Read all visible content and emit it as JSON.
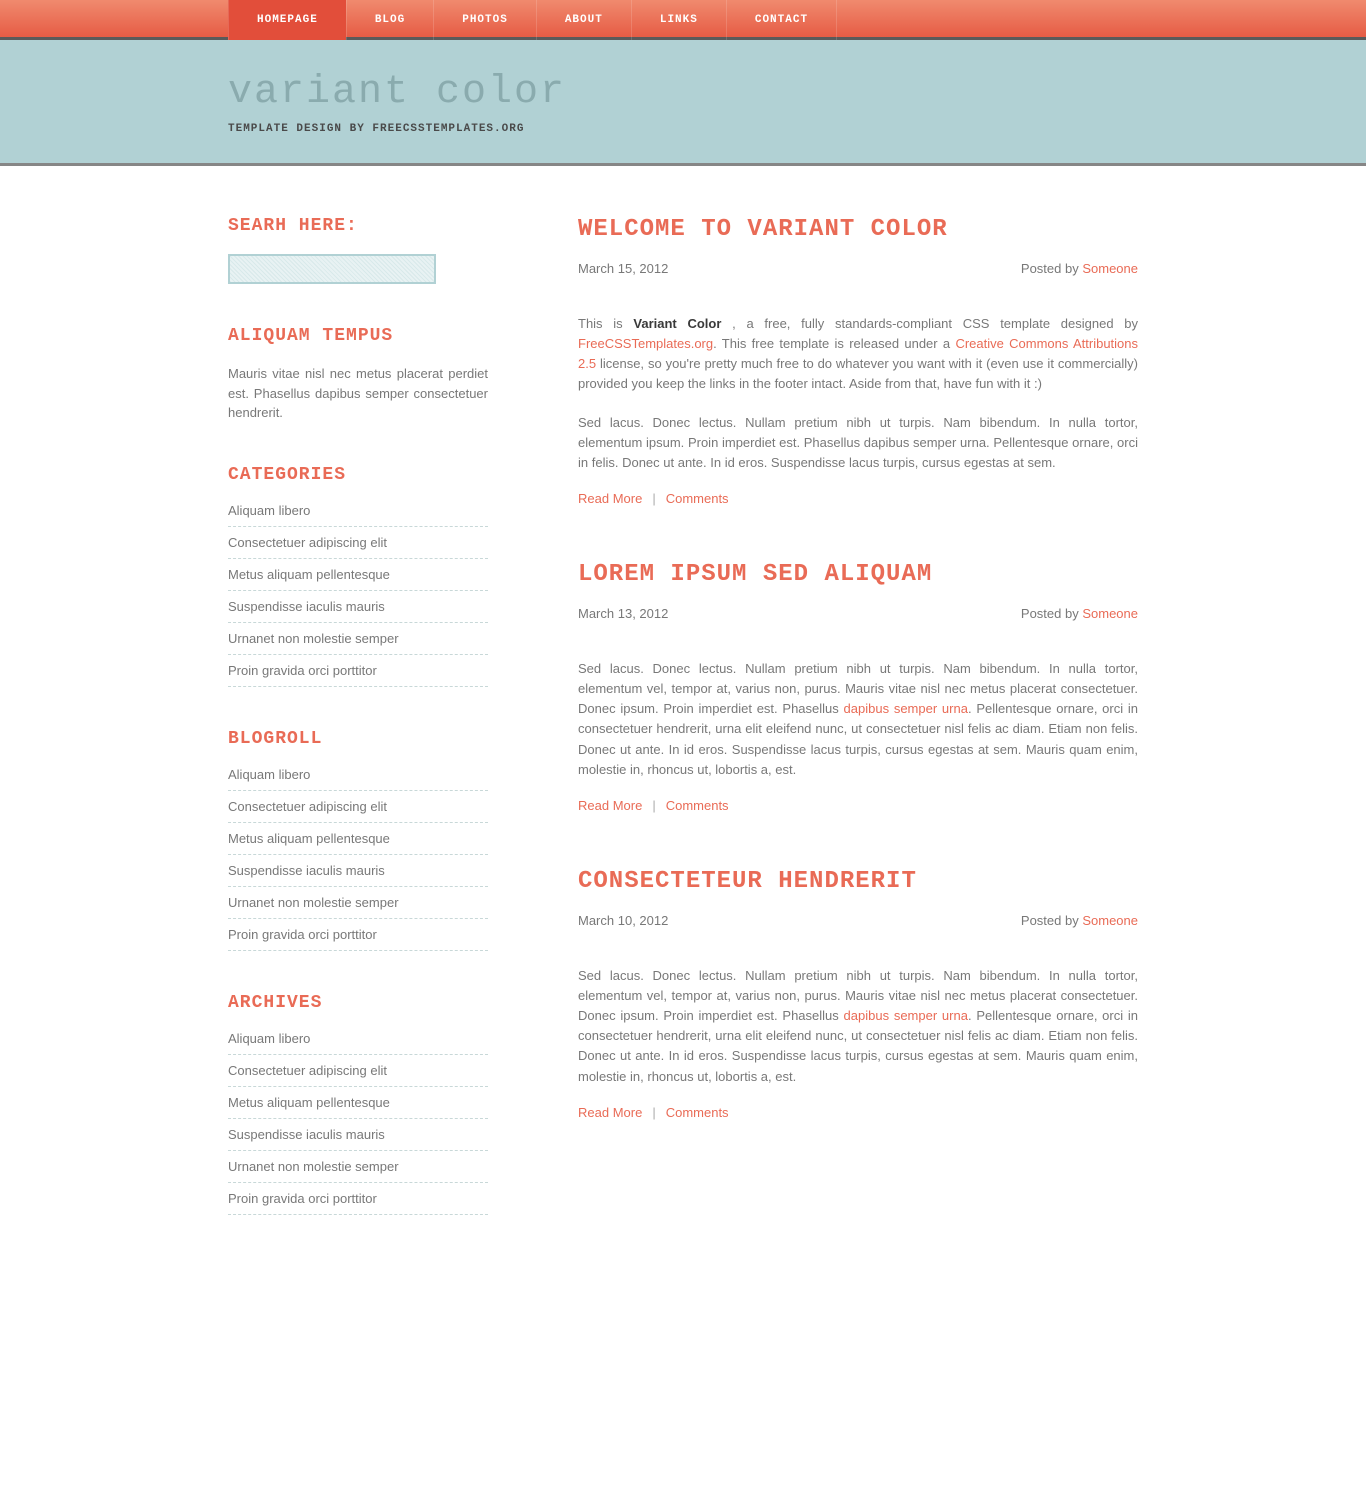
{
  "nav": {
    "items": [
      {
        "label": "Homepage",
        "active": true
      },
      {
        "label": "Blog",
        "active": false
      },
      {
        "label": "Photos",
        "active": false
      },
      {
        "label": "About",
        "active": false
      },
      {
        "label": "Links",
        "active": false
      },
      {
        "label": "Contact",
        "active": false
      }
    ]
  },
  "logo": {
    "title": "variant color",
    "subtitle": "Template design by FreeCSSTemplates.org"
  },
  "sidebar": {
    "search_heading": "Searh Here:",
    "search_value": "",
    "tempus_heading": "Aliquam tempus",
    "tempus_text": "Mauris vitae nisl nec metus placerat perdiet est. Phasellus dapibus semper consectetuer hendrerit.",
    "categories_heading": "Categories",
    "categories": [
      "Aliquam libero",
      "Consectetuer adipiscing elit",
      "Metus aliquam pellentesque",
      "Suspendisse iaculis mauris",
      "Urnanet non molestie semper",
      "Proin gravida orci porttitor"
    ],
    "blogroll_heading": "Blogroll",
    "blogroll": [
      "Aliquam libero",
      "Consectetuer adipiscing elit",
      "Metus aliquam pellentesque",
      "Suspendisse iaculis mauris",
      "Urnanet non molestie semper",
      "Proin gravida orci porttitor"
    ],
    "archives_heading": "Archives",
    "archives": [
      "Aliquam libero",
      "Consectetuer adipiscing elit",
      "Metus aliquam pellentesque",
      "Suspendisse iaculis mauris",
      "Urnanet non molestie semper",
      "Proin gravida orci porttitor"
    ]
  },
  "posts": [
    {
      "title": "Welcome to Variant Color",
      "date": "March 15, 2012",
      "posted_by_label": "Posted by ",
      "author": "Someone",
      "body_html": "This is <strong>Variant Color </strong>, a free, fully standards-compliant CSS template designed by <a class='lnk'>FreeCSSTemplates.org</a>. This free template is released under a <a class='lnk'>Creative Commons Attributions 2.5</a> license, so you're pretty much free to do whatever you want with it (even use it commercially) provided you keep the links in the footer intact. Aside from that, have fun with it :)",
      "body2": "Sed lacus. Donec lectus. Nullam pretium nibh ut turpis. Nam bibendum. In nulla tortor, elementum ipsum. Proin imperdiet est. Phasellus dapibus semper urna. Pellentesque ornare, orci in felis. Donec ut ante. In id eros. Suspendisse lacus turpis, cursus egestas at sem.",
      "read_more": "Read More",
      "comments": "Comments"
    },
    {
      "title": "Lorem ipsum sed aliquam",
      "date": "March 13, 2012",
      "posted_by_label": "Posted by ",
      "author": "Someone",
      "body_html": "Sed lacus. Donec lectus. Nullam pretium nibh ut turpis. Nam bibendum. In nulla tortor, elementum vel, tempor at, varius non, purus. Mauris vitae nisl nec metus placerat consectetuer. Donec ipsum. Proin imperdiet est. Phasellus <a class='lnk'>dapibus semper urna</a>. Pellentesque ornare, orci in consectetuer hendrerit, urna elit eleifend nunc, ut consectetuer nisl felis ac diam. Etiam non felis. Donec ut ante. In id eros. Suspendisse lacus turpis, cursus egestas at sem. Mauris quam enim, molestie in, rhoncus ut, lobortis a, est.",
      "read_more": "Read More",
      "comments": "Comments"
    },
    {
      "title": "Consecteteur hendrerit",
      "date": "March 10, 2012",
      "posted_by_label": "Posted by ",
      "author": "Someone",
      "body_html": "Sed lacus. Donec lectus. Nullam pretium nibh ut turpis. Nam bibendum. In nulla tortor, elementum vel, tempor at, varius non, purus. Mauris vitae nisl nec metus placerat consectetuer. Donec ipsum. Proin imperdiet est. Phasellus <a class='lnk'>dapibus semper urna</a>. Pellentesque ornare, orci in consectetuer hendrerit, urna elit eleifend nunc, ut consectetuer nisl felis ac diam. Etiam non felis. Donec ut ante. In id eros. Suspendisse lacus turpis, cursus egestas at sem. Mauris quam enim, molestie in, rhoncus ut, lobortis a, est.",
      "read_more": "Read More",
      "comments": "Comments"
    }
  ]
}
